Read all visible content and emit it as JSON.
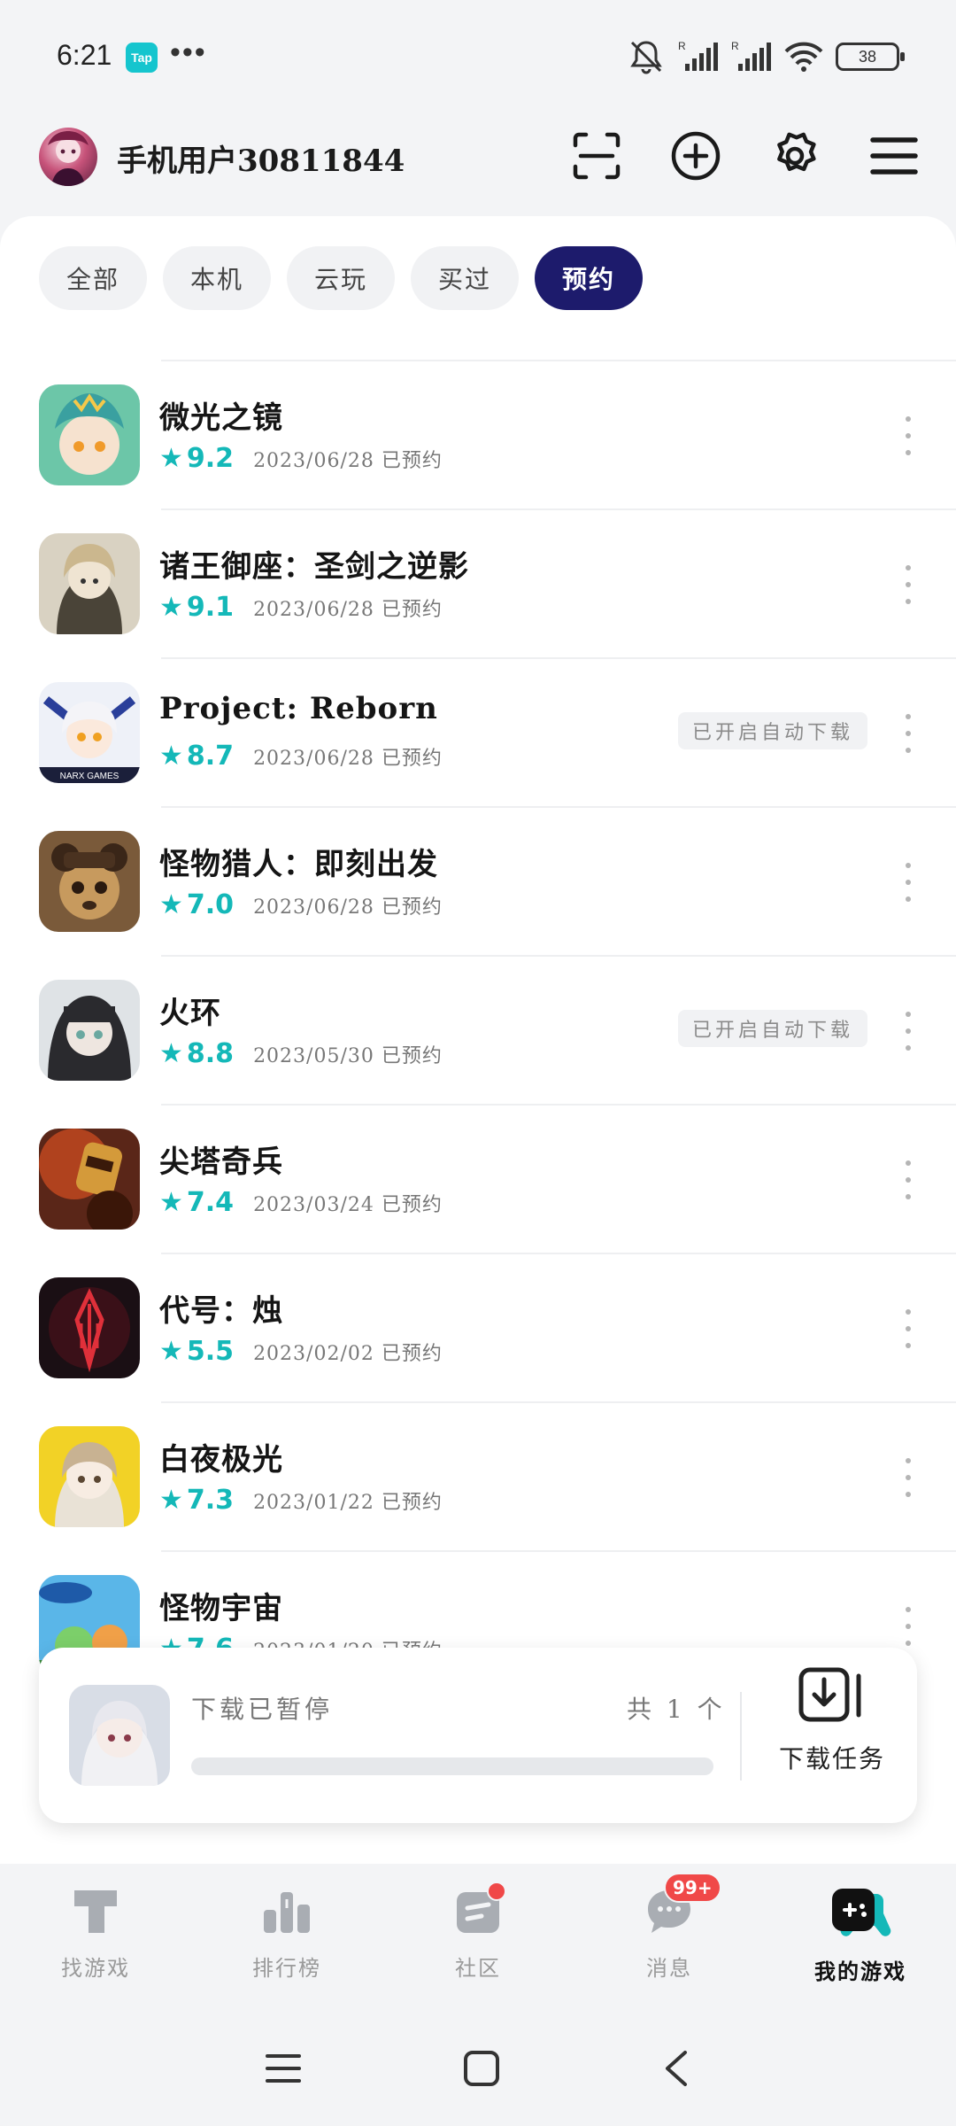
{
  "status_bar": {
    "time": "6:21",
    "app_badge": "Tap",
    "dots": "•••",
    "battery": "38"
  },
  "header": {
    "username": "手机用户30811844"
  },
  "filters": [
    {
      "label": "全部",
      "active": false
    },
    {
      "label": "本机",
      "active": false
    },
    {
      "label": "云玩",
      "active": false
    },
    {
      "label": "买过",
      "active": false
    },
    {
      "label": "预约",
      "active": true
    }
  ],
  "games": [
    {
      "title": "微光之镜",
      "score": "9.2",
      "date": "2023/06/28 已预约",
      "auto_tag": ""
    },
    {
      "title": "诸王御座：圣剑之逆影",
      "score": "9.1",
      "date": "2023/06/28 已预约",
      "auto_tag": ""
    },
    {
      "title": "Project: Reborn",
      "score": "8.7",
      "date": "2023/06/28 已预约",
      "auto_tag": "已开启自动下载"
    },
    {
      "title": "怪物猎人：即刻出发",
      "score": "7.0",
      "date": "2023/06/28 已预约",
      "auto_tag": ""
    },
    {
      "title": "火环",
      "score": "8.8",
      "date": "2023/05/30 已预约",
      "auto_tag": "已开启自动下载"
    },
    {
      "title": "尖塔奇兵",
      "score": "7.4",
      "date": "2023/03/24 已预约",
      "auto_tag": ""
    },
    {
      "title": "代号：烛",
      "score": "5.5",
      "date": "2023/02/02 已预约",
      "auto_tag": ""
    },
    {
      "title": "白夜极光",
      "score": "7.3",
      "date": "2023/01/22 已预约",
      "auto_tag": ""
    },
    {
      "title": "怪物宇宙",
      "score": "7.6",
      "date": "2023/01/20 已预约",
      "auto_tag": ""
    }
  ],
  "download": {
    "status": "下载已暂停",
    "count": "共 1 个",
    "progress": 0,
    "task_label": "下载任务"
  },
  "bottom_nav": [
    {
      "label": "找游戏",
      "icon": "find-games-icon",
      "active": false
    },
    {
      "label": "排行榜",
      "icon": "ranking-icon",
      "active": false
    },
    {
      "label": "社区",
      "icon": "community-icon",
      "active": false,
      "dot": true
    },
    {
      "label": "消息",
      "icon": "message-icon",
      "active": false,
      "badge": "99+"
    },
    {
      "label": "我的游戏",
      "icon": "my-games-icon",
      "active": true
    }
  ],
  "colors": {
    "accent": "#14b8b8",
    "active_chip": "#1d1b6c",
    "badge": "#f04848"
  }
}
